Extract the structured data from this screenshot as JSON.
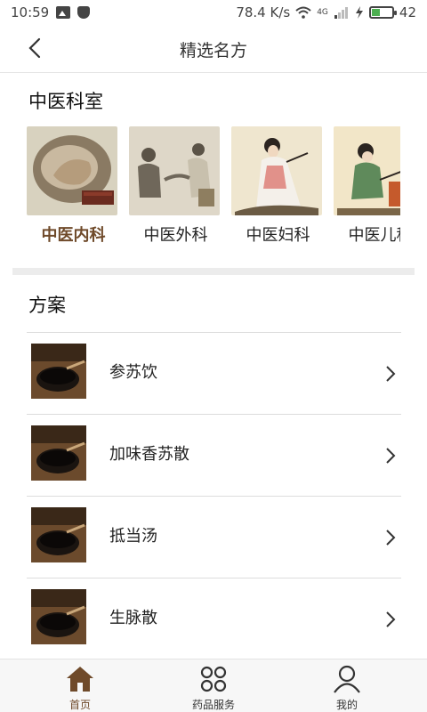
{
  "status_bar": {
    "time": "10:59",
    "speed": "78.4 K/s",
    "network": "4G",
    "battery": "42",
    "battery_level": 0.42
  },
  "header": {
    "title": "精选名方"
  },
  "departments": {
    "title": "中医科室",
    "items": [
      {
        "label": "中医内科",
        "active": true
      },
      {
        "label": "中医外科",
        "active": false
      },
      {
        "label": "中医妇科",
        "active": false
      },
      {
        "label": "中医儿科",
        "active": false
      }
    ]
  },
  "plans": {
    "title": "方案",
    "items": [
      {
        "label": "参苏饮"
      },
      {
        "label": "加味香苏散"
      },
      {
        "label": "抵当汤"
      },
      {
        "label": "生脉散"
      }
    ]
  },
  "tab_bar": {
    "items": [
      {
        "label": "首页",
        "icon": "home-icon",
        "active": true
      },
      {
        "label": "药品服务",
        "icon": "grid-icon",
        "active": false
      },
      {
        "label": "我的",
        "icon": "user-icon",
        "active": false
      }
    ]
  },
  "colors": {
    "accent": "#6f4a2a",
    "divider": "#ececec"
  }
}
